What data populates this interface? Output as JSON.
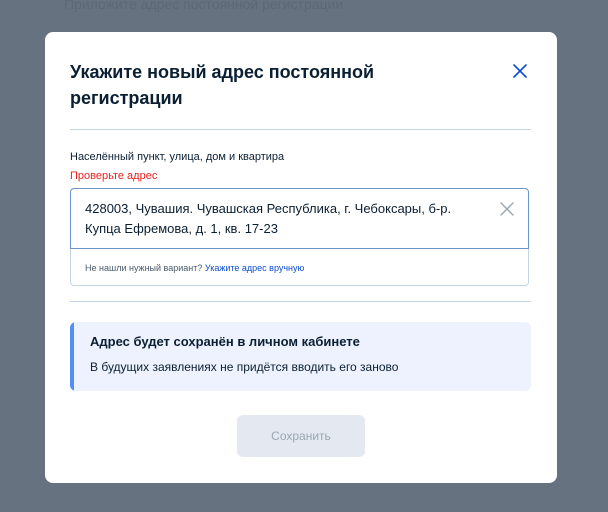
{
  "background": {
    "text": "Приложите адрес постоянной регистрации"
  },
  "modal": {
    "title": "Укажите новый адрес постоянной регистрации",
    "close_icon": "close-icon"
  },
  "address_field": {
    "label": "Населённый пункт, улица, дом и квартира",
    "error": "Проверьте адрес",
    "value": "428003, Чувашия. Чувашская Республика, г. Чебоксары, б-р. Купца Ефремова, д. 1, кв. 17-23",
    "clear_icon": "close-icon",
    "hint_prefix": "Не нашли нужный вариант?",
    "hint_link": "Укажите адрес вручную"
  },
  "info": {
    "title": "Адрес будет сохранён в личном кабинете",
    "text": "В будущих заявлениях не придётся вводить его заново"
  },
  "actions": {
    "save_label": "Сохранить"
  },
  "colors": {
    "backdrop": "#66727f",
    "error": "#e3231f",
    "link": "#0d4cd3",
    "accent": "#4f8ff7",
    "info_bg": "#edf2fe"
  }
}
